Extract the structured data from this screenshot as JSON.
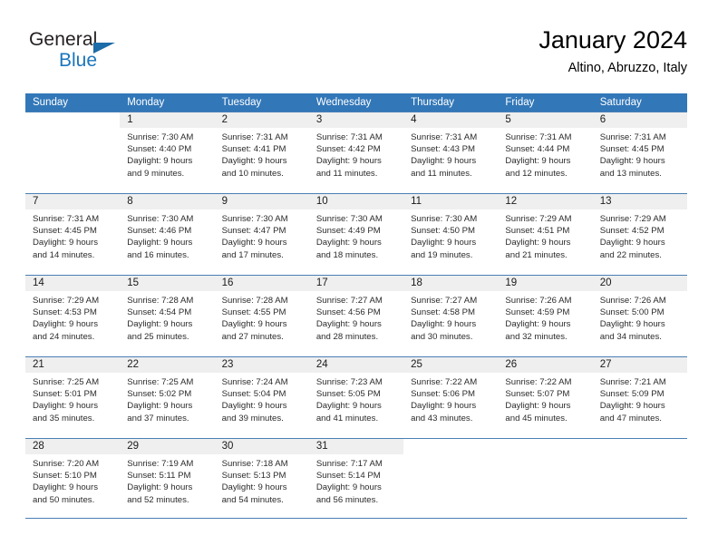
{
  "brand": {
    "name_top": "General",
    "name_bottom": "Blue",
    "triangle_icon": "triangle-icon",
    "color_top": "#231f20",
    "color_bottom": "#1b75bb"
  },
  "header": {
    "title": "January 2024",
    "location": "Altino, Abruzzo, Italy"
  },
  "theme": {
    "header_bg": "#3277b8",
    "header_text": "#ffffff",
    "daynum_bg": "#efefef",
    "row_rule": "#4a7fb5"
  },
  "weekdays": [
    "Sunday",
    "Monday",
    "Tuesday",
    "Wednesday",
    "Thursday",
    "Friday",
    "Saturday"
  ],
  "weeks": [
    [
      {
        "day": "",
        "sunrise": "",
        "sunset": "",
        "daylight_line1": "",
        "daylight_line2": "",
        "blank": true
      },
      {
        "day": "1",
        "sunrise": "Sunrise: 7:30 AM",
        "sunset": "Sunset: 4:40 PM",
        "daylight_line1": "Daylight: 9 hours",
        "daylight_line2": "and 9 minutes."
      },
      {
        "day": "2",
        "sunrise": "Sunrise: 7:31 AM",
        "sunset": "Sunset: 4:41 PM",
        "daylight_line1": "Daylight: 9 hours",
        "daylight_line2": "and 10 minutes."
      },
      {
        "day": "3",
        "sunrise": "Sunrise: 7:31 AM",
        "sunset": "Sunset: 4:42 PM",
        "daylight_line1": "Daylight: 9 hours",
        "daylight_line2": "and 11 minutes."
      },
      {
        "day": "4",
        "sunrise": "Sunrise: 7:31 AM",
        "sunset": "Sunset: 4:43 PM",
        "daylight_line1": "Daylight: 9 hours",
        "daylight_line2": "and 11 minutes."
      },
      {
        "day": "5",
        "sunrise": "Sunrise: 7:31 AM",
        "sunset": "Sunset: 4:44 PM",
        "daylight_line1": "Daylight: 9 hours",
        "daylight_line2": "and 12 minutes."
      },
      {
        "day": "6",
        "sunrise": "Sunrise: 7:31 AM",
        "sunset": "Sunset: 4:45 PM",
        "daylight_line1": "Daylight: 9 hours",
        "daylight_line2": "and 13 minutes."
      }
    ],
    [
      {
        "day": "7",
        "sunrise": "Sunrise: 7:31 AM",
        "sunset": "Sunset: 4:45 PM",
        "daylight_line1": "Daylight: 9 hours",
        "daylight_line2": "and 14 minutes."
      },
      {
        "day": "8",
        "sunrise": "Sunrise: 7:30 AM",
        "sunset": "Sunset: 4:46 PM",
        "daylight_line1": "Daylight: 9 hours",
        "daylight_line2": "and 16 minutes."
      },
      {
        "day": "9",
        "sunrise": "Sunrise: 7:30 AM",
        "sunset": "Sunset: 4:47 PM",
        "daylight_line1": "Daylight: 9 hours",
        "daylight_line2": "and 17 minutes."
      },
      {
        "day": "10",
        "sunrise": "Sunrise: 7:30 AM",
        "sunset": "Sunset: 4:49 PM",
        "daylight_line1": "Daylight: 9 hours",
        "daylight_line2": "and 18 minutes."
      },
      {
        "day": "11",
        "sunrise": "Sunrise: 7:30 AM",
        "sunset": "Sunset: 4:50 PM",
        "daylight_line1": "Daylight: 9 hours",
        "daylight_line2": "and 19 minutes."
      },
      {
        "day": "12",
        "sunrise": "Sunrise: 7:29 AM",
        "sunset": "Sunset: 4:51 PM",
        "daylight_line1": "Daylight: 9 hours",
        "daylight_line2": "and 21 minutes."
      },
      {
        "day": "13",
        "sunrise": "Sunrise: 7:29 AM",
        "sunset": "Sunset: 4:52 PM",
        "daylight_line1": "Daylight: 9 hours",
        "daylight_line2": "and 22 minutes."
      }
    ],
    [
      {
        "day": "14",
        "sunrise": "Sunrise: 7:29 AM",
        "sunset": "Sunset: 4:53 PM",
        "daylight_line1": "Daylight: 9 hours",
        "daylight_line2": "and 24 minutes."
      },
      {
        "day": "15",
        "sunrise": "Sunrise: 7:28 AM",
        "sunset": "Sunset: 4:54 PM",
        "daylight_line1": "Daylight: 9 hours",
        "daylight_line2": "and 25 minutes."
      },
      {
        "day": "16",
        "sunrise": "Sunrise: 7:28 AM",
        "sunset": "Sunset: 4:55 PM",
        "daylight_line1": "Daylight: 9 hours",
        "daylight_line2": "and 27 minutes."
      },
      {
        "day": "17",
        "sunrise": "Sunrise: 7:27 AM",
        "sunset": "Sunset: 4:56 PM",
        "daylight_line1": "Daylight: 9 hours",
        "daylight_line2": "and 28 minutes."
      },
      {
        "day": "18",
        "sunrise": "Sunrise: 7:27 AM",
        "sunset": "Sunset: 4:58 PM",
        "daylight_line1": "Daylight: 9 hours",
        "daylight_line2": "and 30 minutes."
      },
      {
        "day": "19",
        "sunrise": "Sunrise: 7:26 AM",
        "sunset": "Sunset: 4:59 PM",
        "daylight_line1": "Daylight: 9 hours",
        "daylight_line2": "and 32 minutes."
      },
      {
        "day": "20",
        "sunrise": "Sunrise: 7:26 AM",
        "sunset": "Sunset: 5:00 PM",
        "daylight_line1": "Daylight: 9 hours",
        "daylight_line2": "and 34 minutes."
      }
    ],
    [
      {
        "day": "21",
        "sunrise": "Sunrise: 7:25 AM",
        "sunset": "Sunset: 5:01 PM",
        "daylight_line1": "Daylight: 9 hours",
        "daylight_line2": "and 35 minutes."
      },
      {
        "day": "22",
        "sunrise": "Sunrise: 7:25 AM",
        "sunset": "Sunset: 5:02 PM",
        "daylight_line1": "Daylight: 9 hours",
        "daylight_line2": "and 37 minutes."
      },
      {
        "day": "23",
        "sunrise": "Sunrise: 7:24 AM",
        "sunset": "Sunset: 5:04 PM",
        "daylight_line1": "Daylight: 9 hours",
        "daylight_line2": "and 39 minutes."
      },
      {
        "day": "24",
        "sunrise": "Sunrise: 7:23 AM",
        "sunset": "Sunset: 5:05 PM",
        "daylight_line1": "Daylight: 9 hours",
        "daylight_line2": "and 41 minutes."
      },
      {
        "day": "25",
        "sunrise": "Sunrise: 7:22 AM",
        "sunset": "Sunset: 5:06 PM",
        "daylight_line1": "Daylight: 9 hours",
        "daylight_line2": "and 43 minutes."
      },
      {
        "day": "26",
        "sunrise": "Sunrise: 7:22 AM",
        "sunset": "Sunset: 5:07 PM",
        "daylight_line1": "Daylight: 9 hours",
        "daylight_line2": "and 45 minutes."
      },
      {
        "day": "27",
        "sunrise": "Sunrise: 7:21 AM",
        "sunset": "Sunset: 5:09 PM",
        "daylight_line1": "Daylight: 9 hours",
        "daylight_line2": "and 47 minutes."
      }
    ],
    [
      {
        "day": "28",
        "sunrise": "Sunrise: 7:20 AM",
        "sunset": "Sunset: 5:10 PM",
        "daylight_line1": "Daylight: 9 hours",
        "daylight_line2": "and 50 minutes."
      },
      {
        "day": "29",
        "sunrise": "Sunrise: 7:19 AM",
        "sunset": "Sunset: 5:11 PM",
        "daylight_line1": "Daylight: 9 hours",
        "daylight_line2": "and 52 minutes."
      },
      {
        "day": "30",
        "sunrise": "Sunrise: 7:18 AM",
        "sunset": "Sunset: 5:13 PM",
        "daylight_line1": "Daylight: 9 hours",
        "daylight_line2": "and 54 minutes."
      },
      {
        "day": "31",
        "sunrise": "Sunrise: 7:17 AM",
        "sunset": "Sunset: 5:14 PM",
        "daylight_line1": "Daylight: 9 hours",
        "daylight_line2": "and 56 minutes."
      },
      {
        "day": "",
        "sunrise": "",
        "sunset": "",
        "daylight_line1": "",
        "daylight_line2": "",
        "blank": true
      },
      {
        "day": "",
        "sunrise": "",
        "sunset": "",
        "daylight_line1": "",
        "daylight_line2": "",
        "blank": true
      },
      {
        "day": "",
        "sunrise": "",
        "sunset": "",
        "daylight_line1": "",
        "daylight_line2": "",
        "blank": true
      }
    ]
  ]
}
